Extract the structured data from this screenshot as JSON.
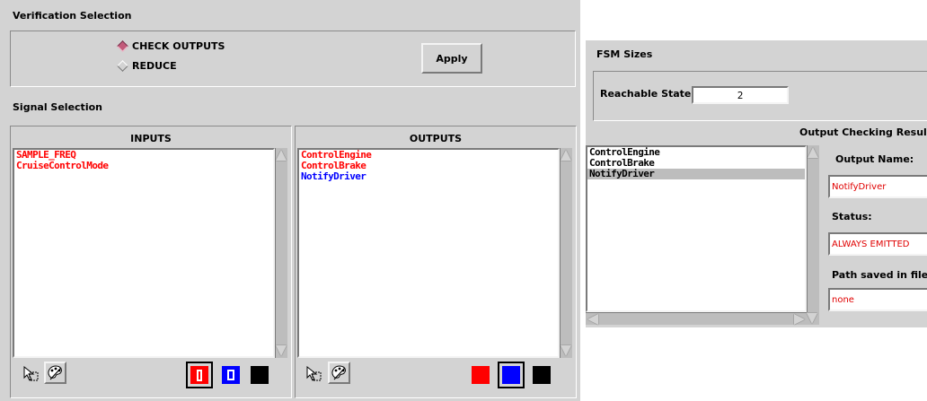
{
  "verification": {
    "section_title": "Verification Selection",
    "options": [
      {
        "label": "CHECK OUTPUTS",
        "selected": true
      },
      {
        "label": "REDUCE",
        "selected": false
      }
    ],
    "apply_label": "Apply"
  },
  "signal": {
    "section_title": "Signal Selection",
    "inputs": {
      "header": "INPUTS",
      "items": [
        {
          "label": "SAMPLE_FREQ",
          "color": "#ff0000"
        },
        {
          "label": "CruiseControlMode",
          "color": "#ff0000"
        }
      ],
      "tool_icons": [
        "pointer-icon",
        "palette-icon"
      ],
      "swatches": [
        {
          "name": "red",
          "color": "#ff0000",
          "glyph": "I",
          "selected": true
        },
        {
          "name": "blue",
          "color": "#0000ff",
          "glyph": "O",
          "selected": false
        },
        {
          "name": "black",
          "color": "#000000",
          "glyph": "",
          "selected": false
        }
      ]
    },
    "outputs": {
      "header": "OUTPUTS",
      "items": [
        {
          "label": "ControlEngine",
          "color": "#ff0000"
        },
        {
          "label": "ControlBrake",
          "color": "#ff0000"
        },
        {
          "label": "NotifyDriver",
          "color": "#0000ff"
        }
      ],
      "tool_icons": [
        "pointer-icon",
        "palette-icon"
      ],
      "swatches": [
        {
          "name": "red",
          "color": "#ff0000",
          "glyph": "",
          "selected": false
        },
        {
          "name": "blue",
          "color": "#0000ff",
          "glyph": "",
          "selected": true
        },
        {
          "name": "black",
          "color": "#000000",
          "glyph": "",
          "selected": false
        }
      ]
    }
  },
  "fsm": {
    "section_title": "FSM Sizes",
    "reachable_label": "Reachable States",
    "reachable_value": "2"
  },
  "results": {
    "section_title": "Output Checking Results",
    "items": [
      "ControlEngine",
      "ControlBrake",
      "NotifyDriver"
    ],
    "selected_index": 2,
    "output_name_label": "Output Name:",
    "output_name_value": "NotifyDriver",
    "status_label": "Status:",
    "status_value": "ALWAYS EMITTED",
    "path_label": "Path saved in file:",
    "path_value": "none",
    "value_color": "#e00000"
  }
}
